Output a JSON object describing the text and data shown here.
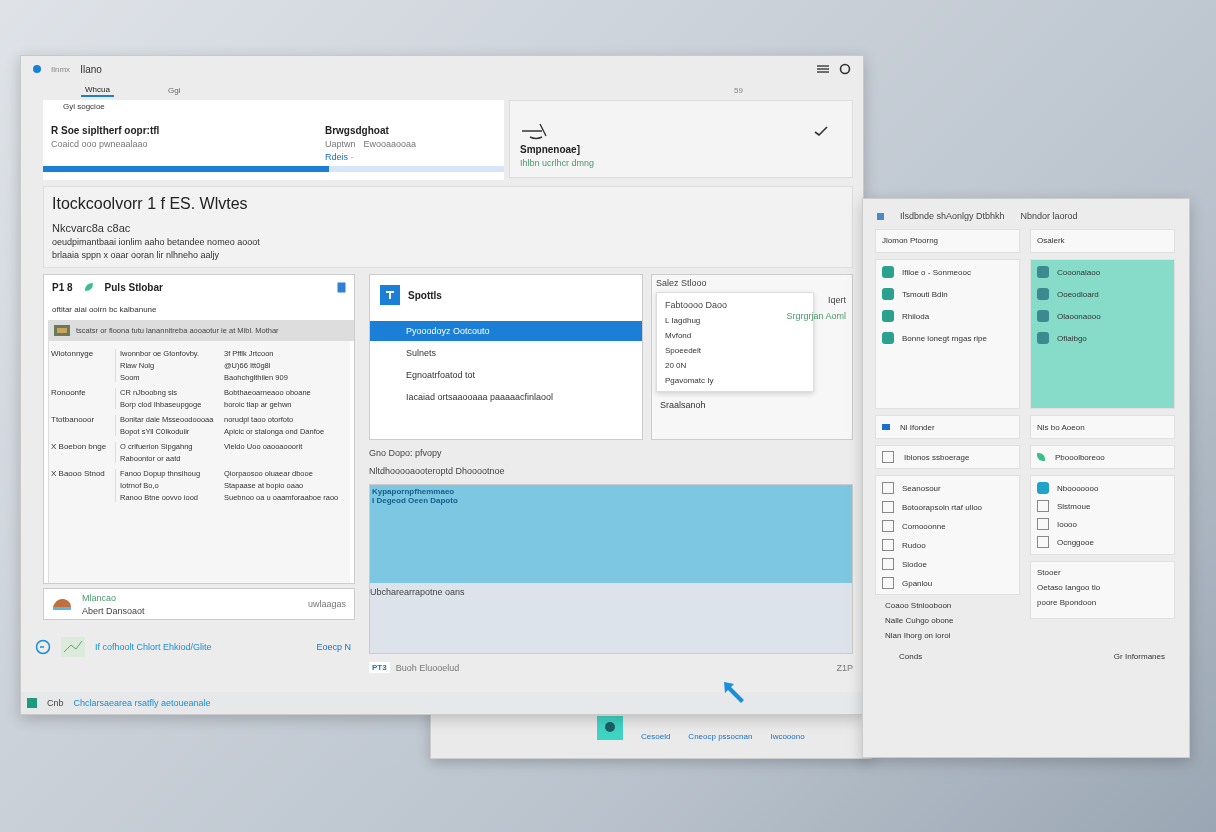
{
  "main_window": {
    "title_small": "Ilnmx",
    "title": "Ilano",
    "tabs": [
      {
        "label": "Whcua",
        "selected": true
      },
      {
        "label": "Ggi",
        "selected": false
      }
    ],
    "tab_count": "59",
    "hero": {
      "caption": "Gyl sogcioe",
      "title": "R Soe sipltherf oopr:tfl",
      "subtitle": "Coaicd ooo  pwneaalaao",
      "right_title": "Brwgsdghoat",
      "right_label": "Uaptwn",
      "right_value": "Ewooaaooaa",
      "link": "Rdeis ·",
      "level": 0.62
    },
    "side_card": {
      "title": "Smpnenoae]",
      "subtitle": "Ihlbn ucrlhcr dmng"
    },
    "section": {
      "heading": "Itockcoolvorr 1 f ES. Wlvtes",
      "subheading": "Nkcvarc8a c8ac",
      "lines": [
        "oeudpimantbaai ionlim aaho betandee nomeo aooot",
        "brlaaia sppn x oaar ooran lir nlhneho aaljy"
      ]
    },
    "panel": {
      "header_left": "P1 8",
      "title": "Puls Stlobar",
      "subtitle": "oftitar aiai ooirn bc kalbanune",
      "toolbar": "tscatsr or floona tutu lanannitreba aooaotur ie at Mibl. Mothar",
      "rows": [
        {
          "label": "Wiotonnyge",
          "lines": [
            [
              "Iwonnbor oe Gtonfovby.",
              "3f Pfflk Jrtcoon"
            ],
            [
              "Rlaw Nolg",
              "@U)66 Itt0g8l"
            ],
            [
              "Soom",
              "Baohchglthilen 909"
            ]
          ]
        },
        {
          "label": "Ronoonfe",
          "lines": [
            [
              "CR nJboobng sis",
              "Bobthaeoarneaoo oboane"
            ],
            [
              "Borp clod Ihbaseupgoge",
              "boroic tlap ar gehwn"
            ]
          ]
        },
        {
          "label": "Ttotbanooor",
          "lines": [
            [
              "Bonitar daie Msseoodoooaa",
              "norudpl taoo otorfoto"
            ],
            [
              "Bopot sYil C0Ikoduiir",
              "Apicic or stalonga ond Danfoe"
            ]
          ]
        },
        {
          "label": "X Boebon bnge",
          "lines": [
            [
              "O crifuerion Sipgahng",
              "Vieido Uoo oaooaooorit"
            ],
            [
              "Raboontor or aatd"
            ]
          ]
        },
        {
          "label": "X Baooo Stnod",
          "lines": [
            [
              "Fanoo Dopup thnsihoug",
              "Qiorpaosoo oluaear dbooe"
            ],
            [
              "Iotrnof Bo,o",
              "Stapaase at bopio oaao"
            ],
            [
              "Ranoo Btne oovvo iood",
              "Suebnoo oa u oaamforaaboe raoo"
            ]
          ]
        }
      ],
      "footer_title": "Mlancao",
      "footer_text": "Abert Dansoaot",
      "footer_right": "uwlaagas"
    },
    "bottom_note": {
      "text": "If cofhoolt Chlort Ehkiod/Glite",
      "link": "Eoecp N"
    },
    "list_card": {
      "title": "Spottls",
      "items": [
        {
          "label": "Pyooodoyz Ootcouto",
          "selected": true
        },
        {
          "label": "Sulnets",
          "selected": false
        },
        {
          "label": "Egnoatrfoatod tot",
          "selected": false
        },
        {
          "label": "Iacaiad ortsaaooaaa paaaaacfinlaool",
          "selected": false
        }
      ]
    },
    "popup_card": {
      "title": "Salez Stlooo",
      "row_left": "Fabtoooo Daoo",
      "row_right": "Iqert",
      "menu": [
        "L Iagdhug",
        "Mvfond",
        "Spoeedelt",
        "20 0N",
        "Pgavomatc Iy"
      ],
      "side_text": "Srgrgrjan Aoml",
      "footer": "Sraalsanoh"
    },
    "preview": {
      "caption": "Gno Dopo: pfvopy",
      "title": "Nltdhooooaooteroptd Dhooootnoe",
      "banner_lines": [
        "Kypapornpfhemmaeo",
        "I Degeod Oeen Dapoto"
      ],
      "note": "Ubcharearrapotne oans",
      "status_badge": "PT3",
      "status_text": "Buoh Eluooelud",
      "status_right": "Z1P"
    },
    "status_bar": {
      "label": "Cnb",
      "text": "Chclarsaearea rsatfly aetoueanale"
    }
  },
  "taskbar": {
    "items": [
      "Cesoeld",
      "Cneocp pssocnan",
      "Iwcooono"
    ]
  },
  "right_window": {
    "title": "Ilsdbnde shAonlgy Dtbhkh",
    "title_right": "Nbndor laorod",
    "search_left": "Jlomon Ptoorng",
    "search_right": "Osalerk",
    "list_a": [
      "Ifiloe o - Sonmeooc",
      "Tsmouti Bdln",
      "Rhiloda",
      "Bonne lonegt rngas ripe"
    ],
    "list_b": [
      "Cooonalaoo",
      "Ooeodloard",
      "Olaoonaooo",
      "Ofiaibgo"
    ],
    "bar_a": "Nl Ifonder",
    "bar_b": "Nls bo Aoeon",
    "row_a": "Iblonos ssboerage",
    "row_b": "Pbooolboreoo",
    "list_c": [
      "Seanosour",
      "Botoorapsoln rtaf ulloo",
      "Comooonne",
      "Rudoo",
      "Slodoe",
      "Gpanlou"
    ],
    "list_d": [
      "Nbooooooo",
      "Slstmoue",
      "Ioooo",
      "Ocnggooe"
    ],
    "card_e": [
      "Stooer",
      "Oetaso Iangoo tlo",
      "poore Bpondoon"
    ],
    "notes": [
      "Coaoo Stnlooboon",
      "Nalle Cuhgo obone",
      "Nlan Ihorg on ioroi"
    ],
    "bottom": [
      "Conds",
      "Gr Informanes"
    ]
  }
}
